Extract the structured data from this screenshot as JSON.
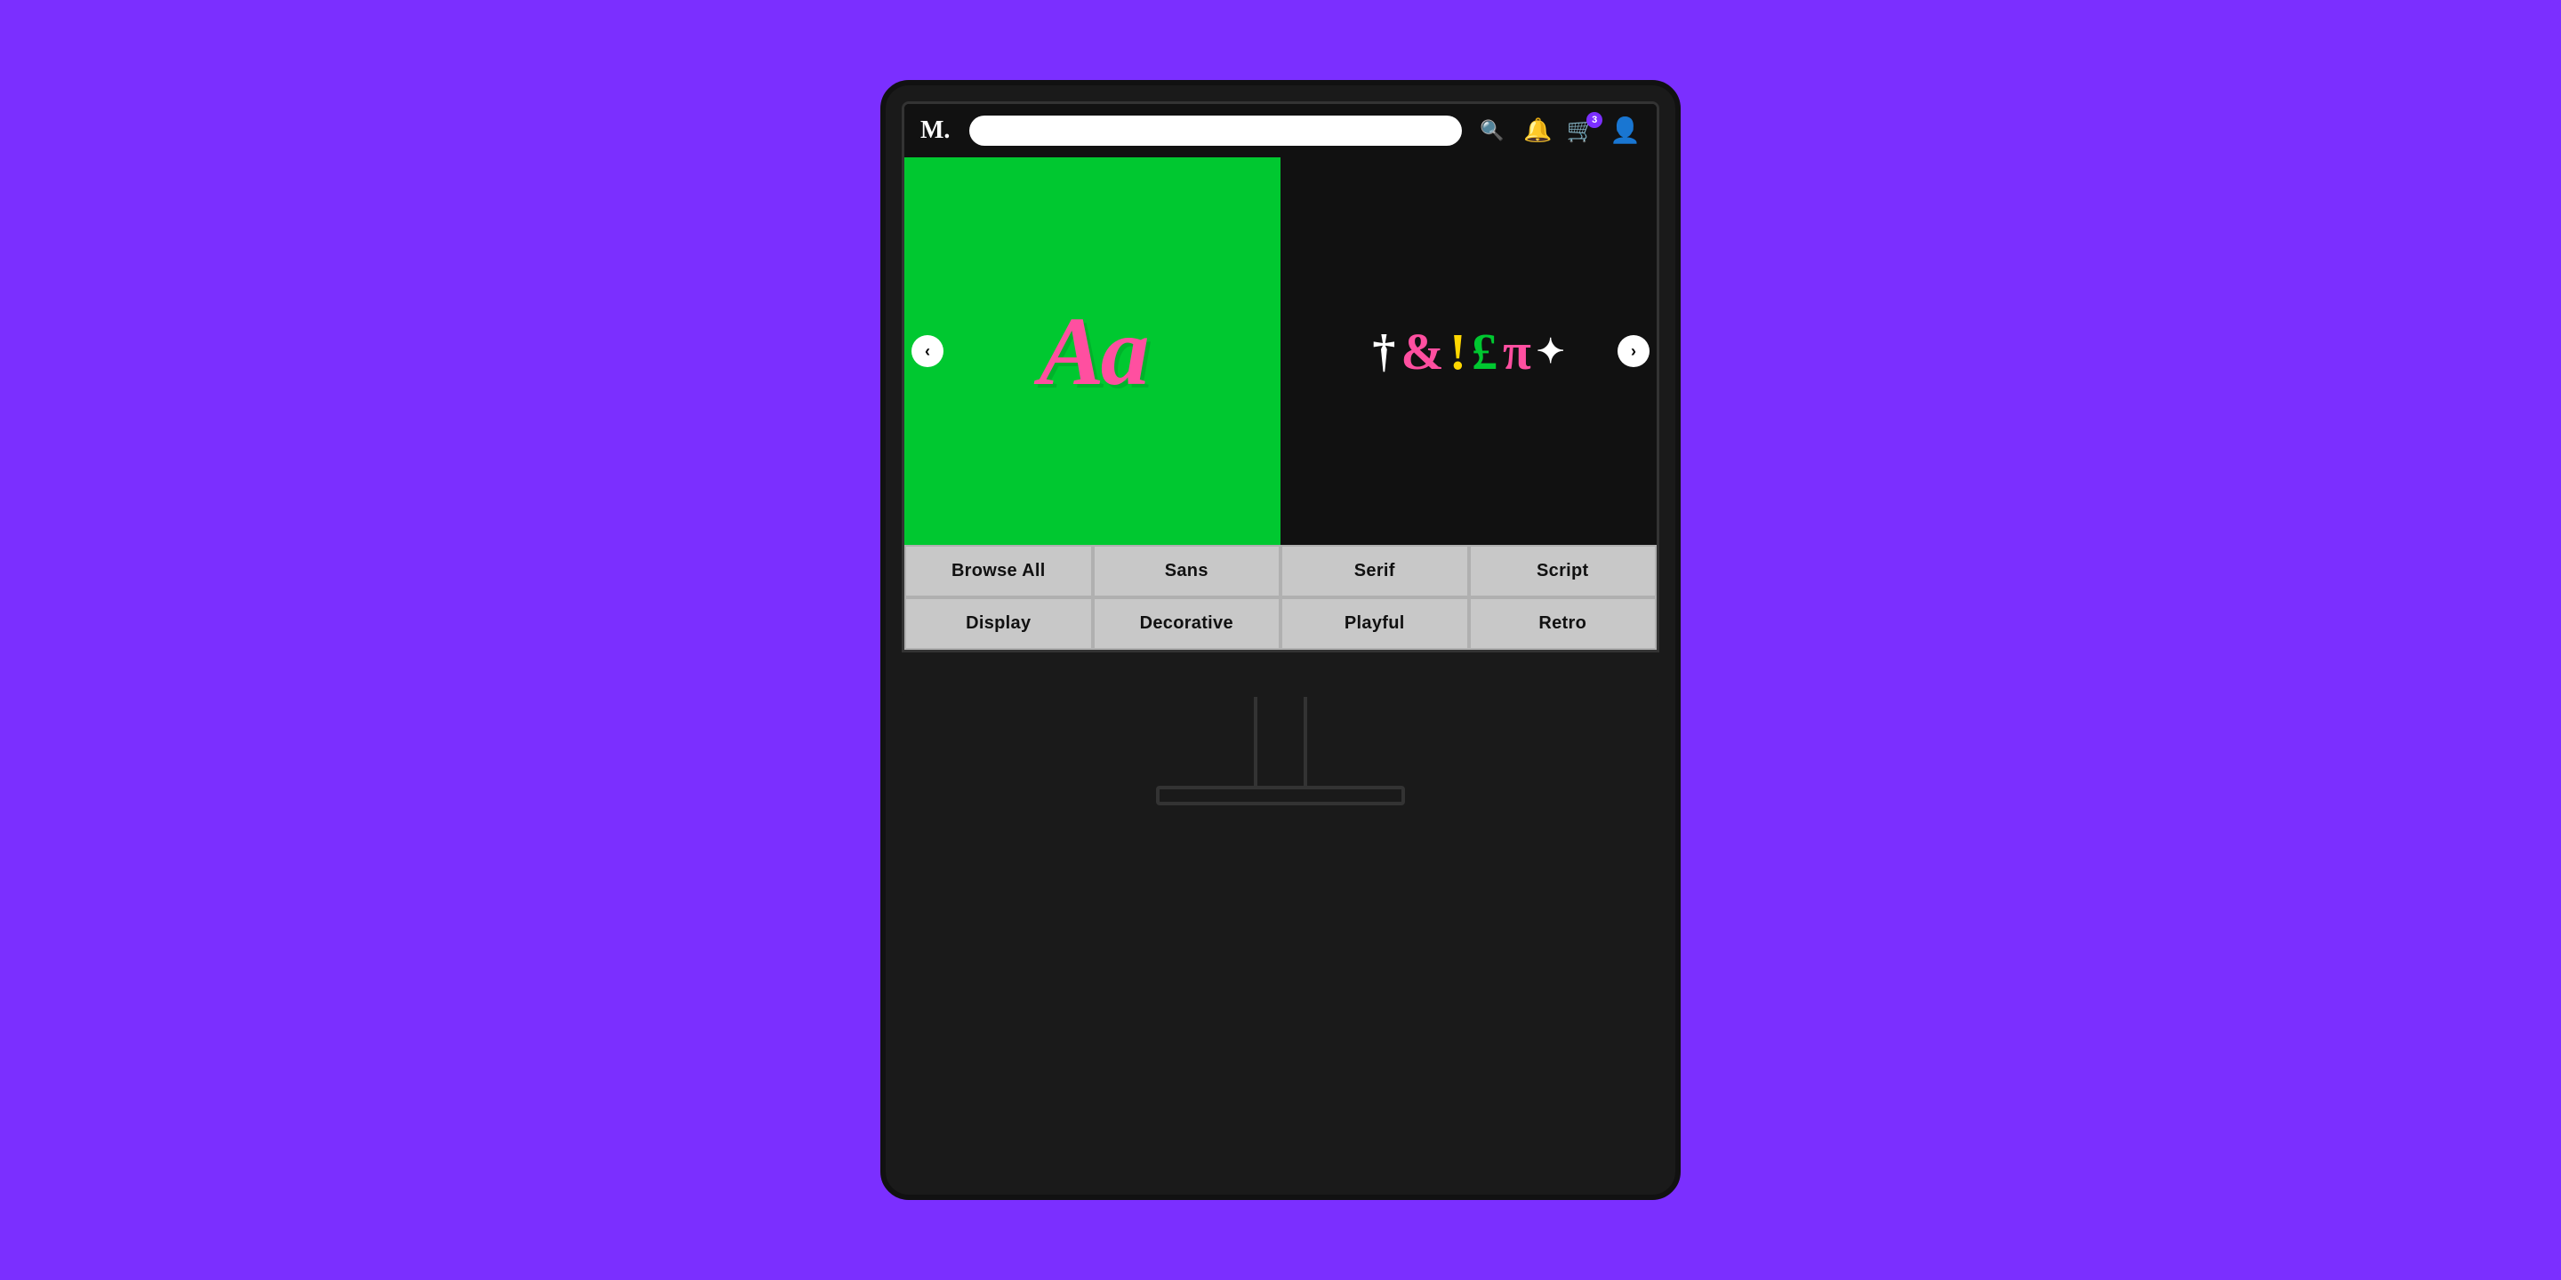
{
  "app": {
    "logo": "M.",
    "search_placeholder": ""
  },
  "navbar": {
    "bell_badge": "",
    "cart_badge": "3",
    "search_icon_label": "🔍"
  },
  "hero": {
    "left_text": "Aa",
    "right_symbols": [
      "†",
      "&",
      "!",
      "£",
      "π",
      "✦"
    ]
  },
  "categories": {
    "row1": [
      "Browse All",
      "Sans",
      "Serif",
      "Script"
    ],
    "row2": [
      "Display",
      "Decorative",
      "Playful",
      "Retro"
    ]
  },
  "carousel": {
    "prev_label": "‹",
    "next_label": "›"
  }
}
